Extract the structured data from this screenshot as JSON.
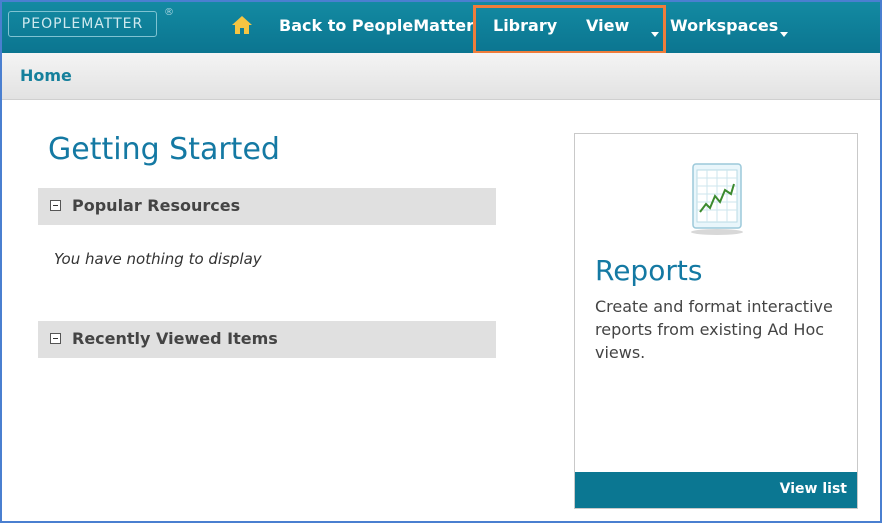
{
  "brand": {
    "logo_text": "PEOPLEMATTER",
    "registered_mark": "®"
  },
  "nav": {
    "home_icon": "home-icon",
    "back_label": "Back to PeopleMatter",
    "library_label": "Library",
    "view_label": "View",
    "workspaces_label": "Workspaces"
  },
  "colors": {
    "nav_bg": "#0e7f99",
    "accent": "#1479a3",
    "highlight": "#ef7d3b",
    "section_bg": "#e0e0e0"
  },
  "breadcrumb": {
    "home_label": "Home"
  },
  "main": {
    "title": "Getting Started",
    "sections": [
      {
        "label": "Popular Resources",
        "empty_text": "You have nothing to display"
      },
      {
        "label": "Recently Viewed Items"
      }
    ]
  },
  "reports_card": {
    "icon": "report-chart-icon",
    "title": "Reports",
    "description": "Create and format interactive reports from existing Ad Hoc views.",
    "link_label": "View list"
  }
}
